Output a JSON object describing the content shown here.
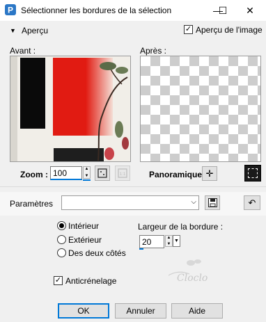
{
  "window": {
    "title": "Sélectionner les bordures de la sélection",
    "minimize": "—",
    "maximize": "☐",
    "close": "✕"
  },
  "preview_header": {
    "label": "Aperçu",
    "image_preview_label": "Aperçu de l'image",
    "image_preview_checked": true
  },
  "before": {
    "label": "Avant :"
  },
  "after": {
    "label": "Après :"
  },
  "zoom": {
    "label": "Zoom :",
    "value": "100"
  },
  "pan": {
    "label": "Panoramique :"
  },
  "params": {
    "label": "Paramètres",
    "value": ""
  },
  "position": {
    "options": [
      {
        "label": "Intérieur",
        "selected": true
      },
      {
        "label": "Extérieur",
        "selected": false
      },
      {
        "label": "Des deux côtés",
        "selected": false
      }
    ]
  },
  "border_width": {
    "label": "Largeur de la bordure :",
    "value": "20"
  },
  "antialias": {
    "label": "Anticrénelage",
    "checked": true
  },
  "watermark": {
    "text": "Cloclo"
  },
  "buttons": {
    "ok": "OK",
    "cancel": "Annuler",
    "help": "Aide"
  },
  "colors": {
    "accent": "#0078d7",
    "dialog_bg": "#f0f0f0"
  }
}
